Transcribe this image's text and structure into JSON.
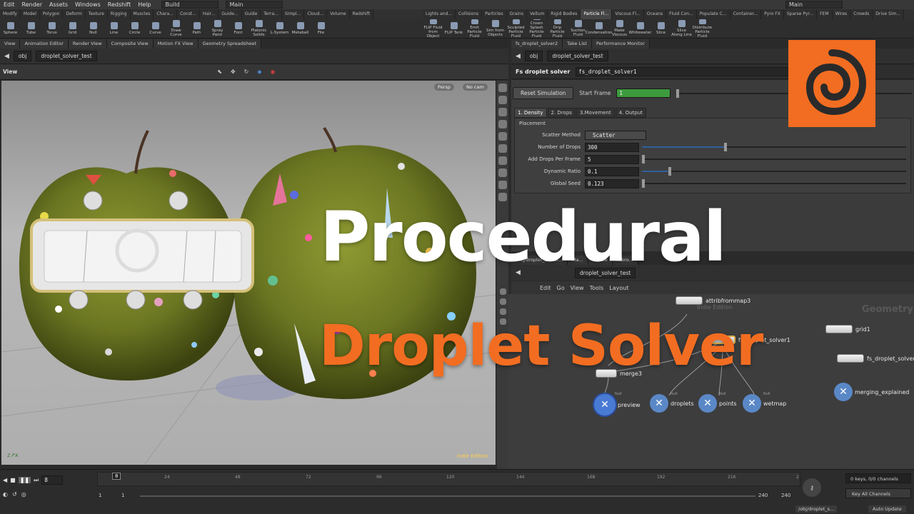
{
  "menu": {
    "items": [
      "Edit",
      "Render",
      "Assets",
      "Windows",
      "Redshift",
      "Help"
    ],
    "desktop_left": "Build",
    "desktop_center": "Main",
    "desktop_right": "Main"
  },
  "shelf": {
    "tabs_left": [
      "Modify",
      "Model",
      "Polygon",
      "Deform",
      "Texture",
      "Rigging",
      "Muscles",
      "Chara...",
      "Const...",
      "Hair...",
      "Guide...",
      "Guide",
      "Terra...",
      "Simpl...",
      "Cloud...",
      "Volume",
      "Redshift"
    ],
    "tabs_right": [
      "Lights and...",
      "Collisions",
      "Particles",
      "Grains",
      "Vellum",
      "Rigid Bodies",
      "Particle Fl...",
      "Viscous Fl...",
      "Oceans",
      "Fluid Con...",
      "Populate C...",
      "Container...",
      "Pyro FX",
      "Sparse Pyr...",
      "FEM",
      "Wires",
      "Crowds",
      "Drive Sim..."
    ],
    "active_right": "Particle Fl...",
    "tools_left": [
      "Sphere",
      "Tube",
      "Torus",
      "Grid",
      "Null",
      "Line",
      "Circle",
      "Curve",
      "Draw Curve",
      "Path",
      "Spray Paint",
      "Font",
      "Platonic Solids",
      "L-System",
      "Metaball",
      "File"
    ],
    "tools_right": [
      "FLIP Fluid from Object",
      "FLIP Tank",
      "Emit Particle Fluid",
      "Sim from Objects",
      "Sculpted Particle Fluid",
      "Crown Splash Particle Fluid",
      "Drip Particle Fluid",
      "Suction Fluid",
      "Condensation",
      "Make Viscous",
      "Whitewater",
      "Slice",
      "Slice Along Line",
      "Distribute Particle Fluid"
    ]
  },
  "left_pane": {
    "tabs": [
      "View",
      "Animation Editor",
      "Render View",
      "Composite View",
      "Motion FX View",
      "Geometry Spreadsheet"
    ],
    "path_root": "obj",
    "path_node": "droplet_solver_test",
    "view_label": "View",
    "persp": "Persp",
    "cam": "No cam",
    "watermark": "Indie Edition"
  },
  "right_pane": {
    "tabs": [
      "fs_droplet_solver2",
      "Take List",
      "Performance Monitor"
    ],
    "path_root": "obj",
    "path_node": "droplet_solver_test",
    "node_type": "Fs droplet solver",
    "node_name": "fs_droplet_solver1",
    "reset_label": "Reset Simulation",
    "start_frame_label": "Start Frame",
    "start_frame_value": "1",
    "param_tabs": [
      "1. Density",
      "2. Drops",
      "3.Movement",
      "4. Output"
    ],
    "placement_label": "Placement",
    "scatter_label": "Scatter Method",
    "scatter_value": "Scatter",
    "params": [
      {
        "label": "Number of Drops",
        "value": "300",
        "fill": 0.31
      },
      {
        "label": "Add Drops Per Frame",
        "value": "5",
        "fill": 0.0
      },
      {
        "label": "Dynamic Ratio",
        "value": "0.1",
        "fill": 0.1
      },
      {
        "label": "Global Seed",
        "value": "0.123",
        "fill": 0.0
      }
    ]
  },
  "network": {
    "tabs": [
      "/obj/droplet_solver...",
      "Ma...",
      "...lette",
      "...bro..."
    ],
    "path_node": "droplet_solver_test",
    "menu": [
      "Edit",
      "Go",
      "View",
      "Tools",
      "Layout"
    ],
    "context_label": "Geometry",
    "watermark": "Indie Edition",
    "nodes": {
      "attrib": "attribfrommap3",
      "solver1": "fs_droplet_solver1",
      "solver2": "fs_droplet_solver2",
      "grid": "grid1",
      "merge": "merge3",
      "merging": "merging_explained",
      "null_type": "Null",
      "preview": "preview",
      "droplets": "droplets",
      "points": "points",
      "wetmap": "wetmap"
    }
  },
  "timeline": {
    "current_frame": "8",
    "frame_marker": "8",
    "ticks": [
      "24",
      "48",
      "72",
      "96",
      "120",
      "144",
      "168",
      "192",
      "216",
      "2"
    ],
    "range_start": "1",
    "range_start2": "1",
    "range_end": "240",
    "range_end2": "240",
    "keys_label": "0 keys, 0/0 channels",
    "key_all": "Key All Channels",
    "status_path": "/obj/droplet_s...",
    "auto_update": "Auto Update"
  },
  "overlay": {
    "title_line1": "Procedural",
    "title_line2": "Droplet Solver"
  },
  "colors": {
    "accent_orange": "#f26d21",
    "start_frame_green": "#3d9a3d",
    "slider_blue": "#2e5f9b"
  }
}
